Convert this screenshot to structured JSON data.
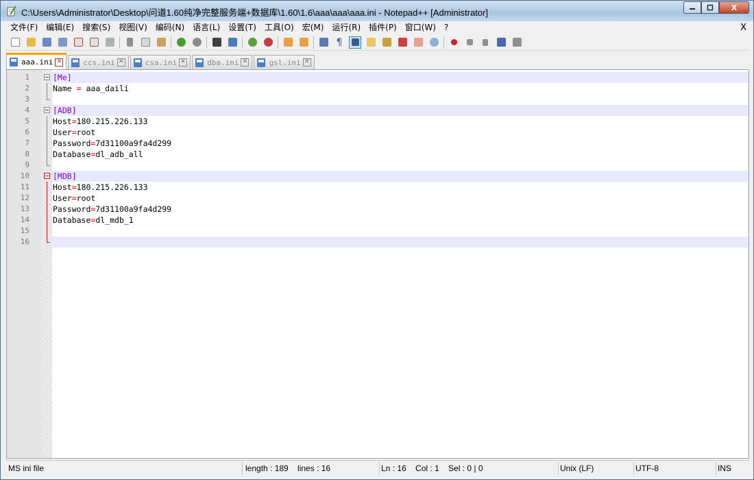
{
  "window": {
    "title": "C:\\Users\\Administrator\\Desktop\\问道1.60纯净完整服务端+数据库\\1.60\\1.6\\aaa\\aaa\\aaa.ini - Notepad++ [Administrator]",
    "minimize_icon": "minimize-icon",
    "maximize_icon": "maximize-icon",
    "close_glyph": "X"
  },
  "menu": {
    "items": [
      "文件(F)",
      "编辑(E)",
      "搜索(S)",
      "视图(V)",
      "编码(N)",
      "语言(L)",
      "设置(T)",
      "工具(O)",
      "宏(M)",
      "运行(R)",
      "插件(P)",
      "窗口(W)",
      "?"
    ],
    "close_label": "X"
  },
  "tabs": [
    {
      "label": "aaa.ini",
      "active": true
    },
    {
      "label": "ccs.ini",
      "active": false
    },
    {
      "label": "csa.ini",
      "active": false
    },
    {
      "label": "dba.ini",
      "active": false
    },
    {
      "label": "gsl.ini",
      "active": false
    }
  ],
  "editor": {
    "lines": [
      {
        "num": "1",
        "text": "[Me]"
      },
      {
        "num": "2",
        "text": "Name = aaa_daili"
      },
      {
        "num": "3",
        "text": ""
      },
      {
        "num": "4",
        "text": "[ADB]"
      },
      {
        "num": "5",
        "text": "Host=180.215.226.133"
      },
      {
        "num": "6",
        "text": "User=root"
      },
      {
        "num": "7",
        "text": "Password=7d31100a9fa4d299"
      },
      {
        "num": "8",
        "text": "Database=dl_adb_all"
      },
      {
        "num": "9",
        "text": ""
      },
      {
        "num": "10",
        "text": "[MDB]"
      },
      {
        "num": "11",
        "text": "Host=180.215.226.133"
      },
      {
        "num": "12",
        "text": "User=root"
      },
      {
        "num": "13",
        "text": "Password=7d31100a9fa4d299"
      },
      {
        "num": "14",
        "text": "Database=dl_mdb_1"
      },
      {
        "num": "15",
        "text": ""
      },
      {
        "num": "16",
        "text": ""
      }
    ],
    "colors": {
      "section": "#8000ff",
      "operator": "#ff0000",
      "current_line": "#e8e8ff"
    }
  },
  "status": {
    "file_type": "MS ini file",
    "length_lines": "length : 189    lines : 16",
    "position": "Ln : 16    Col : 1    Sel : 0 | 0",
    "eol": "Unix (LF)",
    "encoding": "UTF-8",
    "mode": "INS"
  }
}
